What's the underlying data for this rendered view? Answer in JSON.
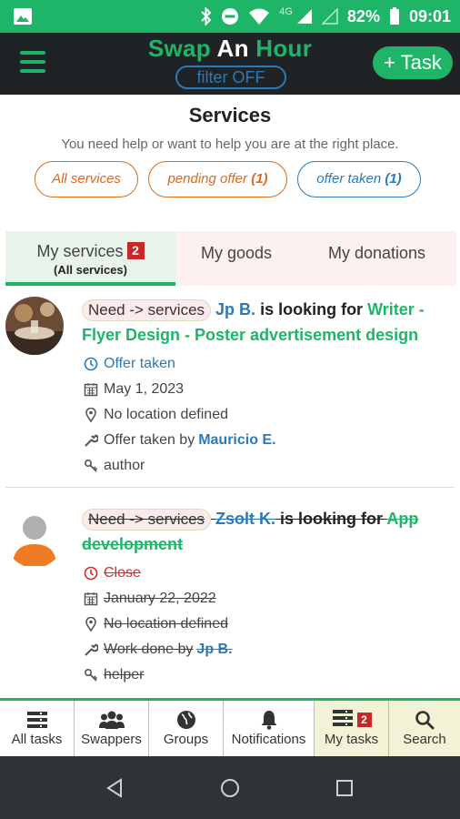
{
  "status_bar": {
    "network": "4G",
    "battery": "82%",
    "time": "09:01"
  },
  "app_bar": {
    "title_part1": "Swap ",
    "title_part2": "An",
    "title_part3": " Hour",
    "filter_label": "filter OFF",
    "task_button": "+ Task"
  },
  "services": {
    "title": "Services",
    "subtitle": "You need help or want to help you are at the right place.",
    "filters": [
      {
        "label": "All services",
        "count": ""
      },
      {
        "label": "pending offer ",
        "count": "(1)"
      },
      {
        "label": "offer taken ",
        "count": "(1)"
      }
    ]
  },
  "tabs": [
    {
      "label": "My services",
      "badge": "2",
      "sub": "(All services)"
    },
    {
      "label": "My goods"
    },
    {
      "label": "My donations"
    }
  ],
  "tasks": [
    {
      "need": "Need -> services",
      "user": "Jp B.",
      "looking": " is looking for ",
      "title": "Writer - Flyer Design - Poster advertisement design",
      "status": "Offer taken",
      "date": "May 1, 2023",
      "location": "No location defined",
      "action_text": "Offer taken by",
      "action_user": "Mauricio E.",
      "role": "author"
    },
    {
      "need": "Need -> services",
      "user": "Zsolt K.",
      "looking": " is looking for ",
      "title": "App development",
      "status": "Close",
      "date": "January 22, 2022",
      "location": "No location defined",
      "action_text": "Work done by",
      "action_user": "Jp B.",
      "role": "helper"
    }
  ],
  "bottom_nav": [
    {
      "label": "All tasks",
      "icon": "list-icon"
    },
    {
      "label": "Swappers",
      "icon": "users-icon"
    },
    {
      "label": "Groups",
      "icon": "globe-icon"
    },
    {
      "label": "Notifications",
      "icon": "bell-icon"
    },
    {
      "label": "My tasks",
      "icon": "list-icon",
      "badge": "2"
    },
    {
      "label": "Search",
      "icon": "search-icon"
    }
  ],
  "colors": {
    "brand_green": "#1fb569",
    "link_blue": "#2a7ab8",
    "accent_orange": "#d96a1e",
    "badge_red": "#c62828"
  }
}
